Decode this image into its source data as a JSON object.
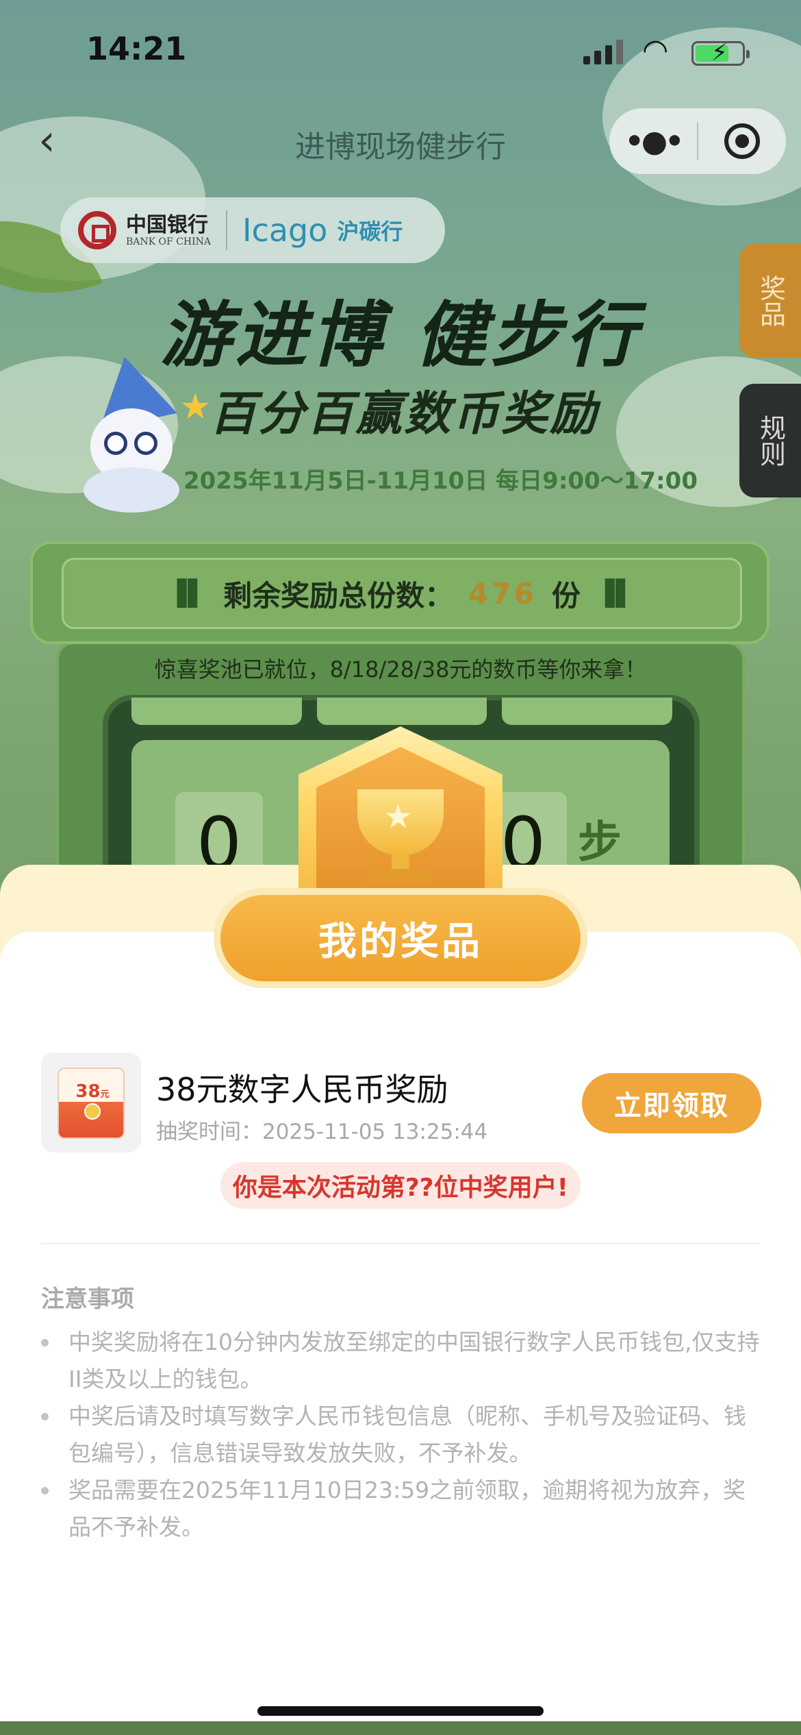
{
  "status_bar": {
    "time": "14:21"
  },
  "nav": {
    "title": "进博现场健步行",
    "more_icon": "more-dots-icon",
    "close_icon": "target-close-icon"
  },
  "logos": {
    "boc_cn": "中国银行",
    "boc_en": "BANK OF CHINA",
    "partner_en": "Icago",
    "partner_cn": "沪碳行"
  },
  "side_tabs": {
    "prize": "奖品",
    "rules": "规则"
  },
  "banner": {
    "headline": "游进博 健步行",
    "subhead": "百分百赢数币奖励",
    "date": "2025年11月5日-11月10日 每日9:00～17:00"
  },
  "counter": {
    "label": "剩余奖励总份数：",
    "value": "476",
    "unit": "份"
  },
  "pool_text": "惊喜奖池已就位，8/18/28/38元的数币等你来拿！",
  "steps": {
    "digit_first": "0",
    "digit_last": "0",
    "unit": "步"
  },
  "sheet": {
    "title": "我的奖品",
    "prize": {
      "envelope_amount": "38",
      "envelope_unit": "元",
      "name": "38元数字人民币奖励",
      "time_label": "抽奖时间：",
      "time_value": "2025-11-05 13:25:44",
      "claim_label": "立即领取"
    },
    "winner_text": "你是本次活动第??位中奖用户!",
    "notes_title": "注意事项",
    "notes": [
      "中奖奖励将在10分钟内发放至绑定的中国银行数字人民币钱包,仅支持II类及以上的钱包。",
      "中奖后请及时填写数字人民币钱包信息（昵称、手机号及验证码、钱包编号），信息错误导致发放失败，不予补发。",
      "奖品需要在2025年11月10日23:59之前领取，逾期将视为放弃，奖品不予补发。"
    ]
  },
  "colors": {
    "accent_orange": "#efa63a",
    "winner_red": "#d8352c",
    "sheet_cream": "#fdf3cf"
  }
}
